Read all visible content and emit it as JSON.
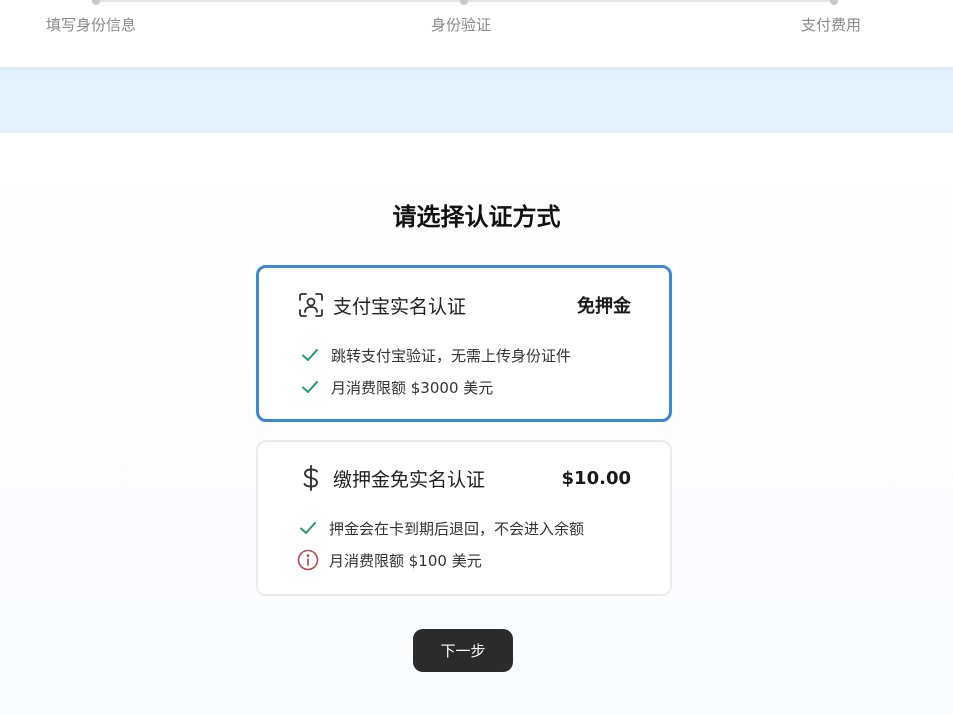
{
  "steps": [
    {
      "label": "填写身份信息"
    },
    {
      "label": "身份验证"
    },
    {
      "label": "支付费用"
    }
  ],
  "main": {
    "title": "请选择认证方式",
    "options": [
      {
        "icon": "face-scan-icon",
        "title": "支付宝实名认证",
        "price": "免押金",
        "selected": true,
        "features": [
          {
            "icon": "check-icon",
            "text": "跳转支付宝验证，无需上传身份证件"
          },
          {
            "icon": "check-icon",
            "text": "月消费限额 $3000 美元"
          }
        ]
      },
      {
        "icon": "dollar-icon",
        "title": "缴押金免实名认证",
        "price": "$10.00",
        "selected": false,
        "features": [
          {
            "icon": "check-icon",
            "text": "押金会在卡到期后退回，不会进入余额"
          },
          {
            "icon": "info-icon",
            "text": "月消费限额 $100 美元"
          }
        ]
      }
    ],
    "next_label": "下一步"
  },
  "colors": {
    "selected_border": "#3a88d6",
    "check": "#1f9d6b",
    "info": "#b5474f",
    "band": "#e3f2fe",
    "button": "#2b2b2b"
  }
}
